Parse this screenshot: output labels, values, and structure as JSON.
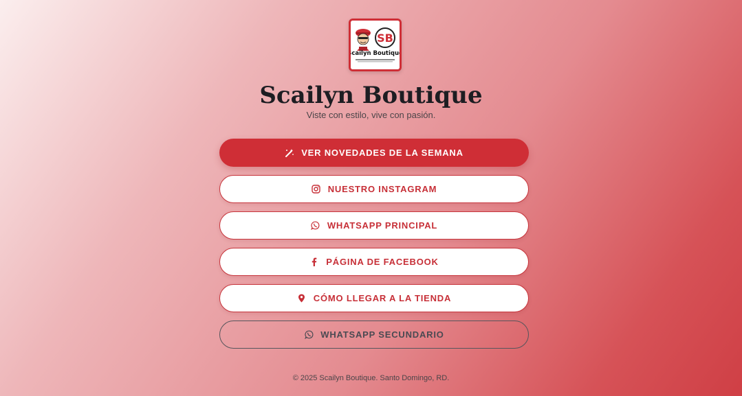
{
  "logo": {
    "text": "Scailyn Boutique",
    "monogram": "SB"
  },
  "header": {
    "title": "Scailyn Boutique",
    "tagline": "Viste con estilo, vive con pasión."
  },
  "buttons": [
    {
      "label": "VER NOVEDADES DE LA SEMANA",
      "icon": "magic-wand-icon",
      "style": "primary"
    },
    {
      "label": "NUESTRO INSTAGRAM",
      "icon": "instagram-icon",
      "style": "white"
    },
    {
      "label": "WHATSAPP PRINCIPAL",
      "icon": "whatsapp-icon",
      "style": "white"
    },
    {
      "label": "PÁGINA DE FACEBOOK",
      "icon": "facebook-icon",
      "style": "white"
    },
    {
      "label": "CÓMO LLEGAR A LA TIENDA",
      "icon": "map-pin-icon",
      "style": "white"
    },
    {
      "label": "WHATSAPP SECUNDARIO",
      "icon": "whatsapp-icon",
      "style": "outline"
    }
  ],
  "footer": {
    "text": "© 2025 Scailyn Boutique. Santo Domingo, RD."
  },
  "colors": {
    "accent": "#cf2e36",
    "title": "#1d1d22",
    "outline": "#55555c"
  }
}
